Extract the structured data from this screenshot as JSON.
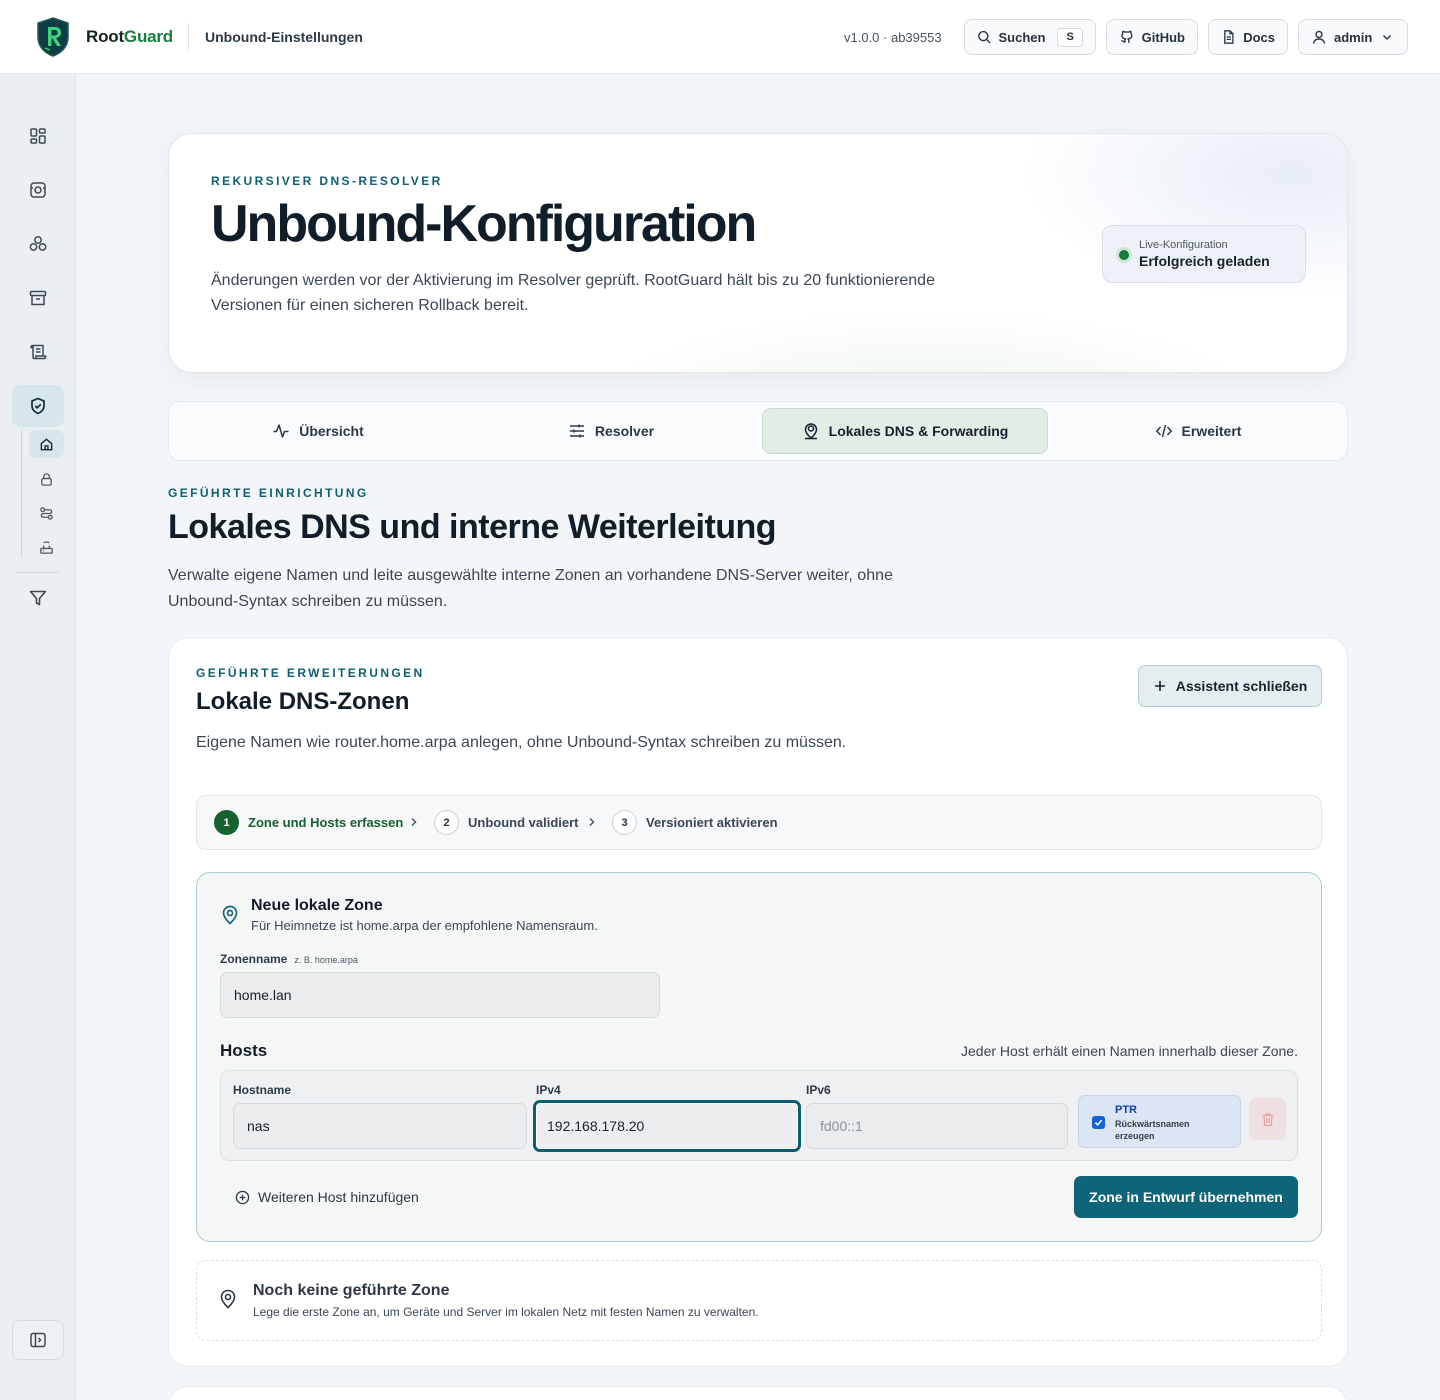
{
  "header": {
    "brand_part1": "Root",
    "brand_part2": "Guard",
    "title": "Unbound-Einstellungen",
    "version": "v1.0.0 · ab39553",
    "search_label": "Suchen",
    "search_shortcut": "S",
    "github_label": "GitHub",
    "docs_label": "Docs",
    "user_label": "admin"
  },
  "sidebar": {
    "items": [
      {
        "icon": "dashboard-icon"
      },
      {
        "icon": "scan-icon"
      },
      {
        "icon": "network-icon"
      },
      {
        "icon": "archive-icon"
      },
      {
        "icon": "scroll-icon"
      },
      {
        "icon": "shield-check-icon",
        "active": true
      },
      {
        "icon": "filter-icon"
      }
    ],
    "subitems": [
      {
        "icon": "home-icon",
        "active": true
      },
      {
        "icon": "lock-icon"
      },
      {
        "icon": "route-icon"
      },
      {
        "icon": "router-icon"
      }
    ],
    "collapse_icon": "sidebar-toggle-icon"
  },
  "hero": {
    "eyebrow": "Rekursiver DNS-Resolver",
    "title": "Unbound-Konfiguration",
    "description": "Änderungen werden vor der Aktivierung im Resolver geprüft. RootGuard hält bis zu 20 funktionierende Versionen für einen sicheren Rollback bereit.",
    "status_label": "Live-Konfiguration",
    "status_value": "Erfolgreich geladen",
    "status_color": "#1a7a3e"
  },
  "tabs": [
    {
      "label": "Übersicht",
      "icon": "activity-icon"
    },
    {
      "label": "Resolver",
      "icon": "sliders-icon"
    },
    {
      "label": "Lokales DNS & Forwarding",
      "icon": "user-pin-icon",
      "active": true
    },
    {
      "label": "Erweitert",
      "icon": "code-icon"
    }
  ],
  "section": {
    "eyebrow": "Geführte Einrichtung",
    "title": "Lokales DNS und interne Weiterleitung",
    "description": "Verwalte eigene Namen und leite ausgewählte interne Zonen an vorhandene DNS-Server weiter, ohne Unbound-Syntax schreiben zu müssen."
  },
  "card": {
    "eyebrow": "Geführte Erweiterungen",
    "title": "Lokale DNS-Zonen",
    "description": "Eigene Namen wie router.home.arpa anlegen, ohne Unbound-Syntax schreiben zu müssen.",
    "assistant_button": "Assistent schließen",
    "steps": [
      {
        "num": "1",
        "label": "Zone und Hosts erfassen",
        "active": true
      },
      {
        "num": "2",
        "label": "Unbound validiert"
      },
      {
        "num": "3",
        "label": "Versioniert aktivieren"
      }
    ],
    "form": {
      "title": "Neue lokale Zone",
      "subtitle": "Für Heimnetze ist home.arpa der empfohlene Namensraum.",
      "zone_label": "Zonenname",
      "zone_hint": "z. B. home.arpa",
      "zone_value": "home.lan",
      "hosts_title": "Hosts",
      "hosts_hint": "Jeder Host erhält einen Namen innerhalb dieser Zone.",
      "host_columns": {
        "hostname": "Hostname",
        "ipv4": "IPv4",
        "ipv6": "IPv6"
      },
      "host": {
        "hostname": "nas",
        "ipv4": "192.168.178.20",
        "ipv6": "",
        "ipv6_placeholder": "fd00::1",
        "ptr_title": "PTR",
        "ptr_subtitle": "Rückwärtsnamen erzeugen",
        "ptr_checked": true
      },
      "add_host_label": "Weiteren Host hinzufügen",
      "apply_button": "Zone in Entwurf übernehmen"
    },
    "empty": {
      "title": "Noch keine geführte Zone",
      "subtitle": "Lege die erste Zone an, um Geräte und Server im lokalen Netz mit festen Namen zu verwalten."
    }
  }
}
